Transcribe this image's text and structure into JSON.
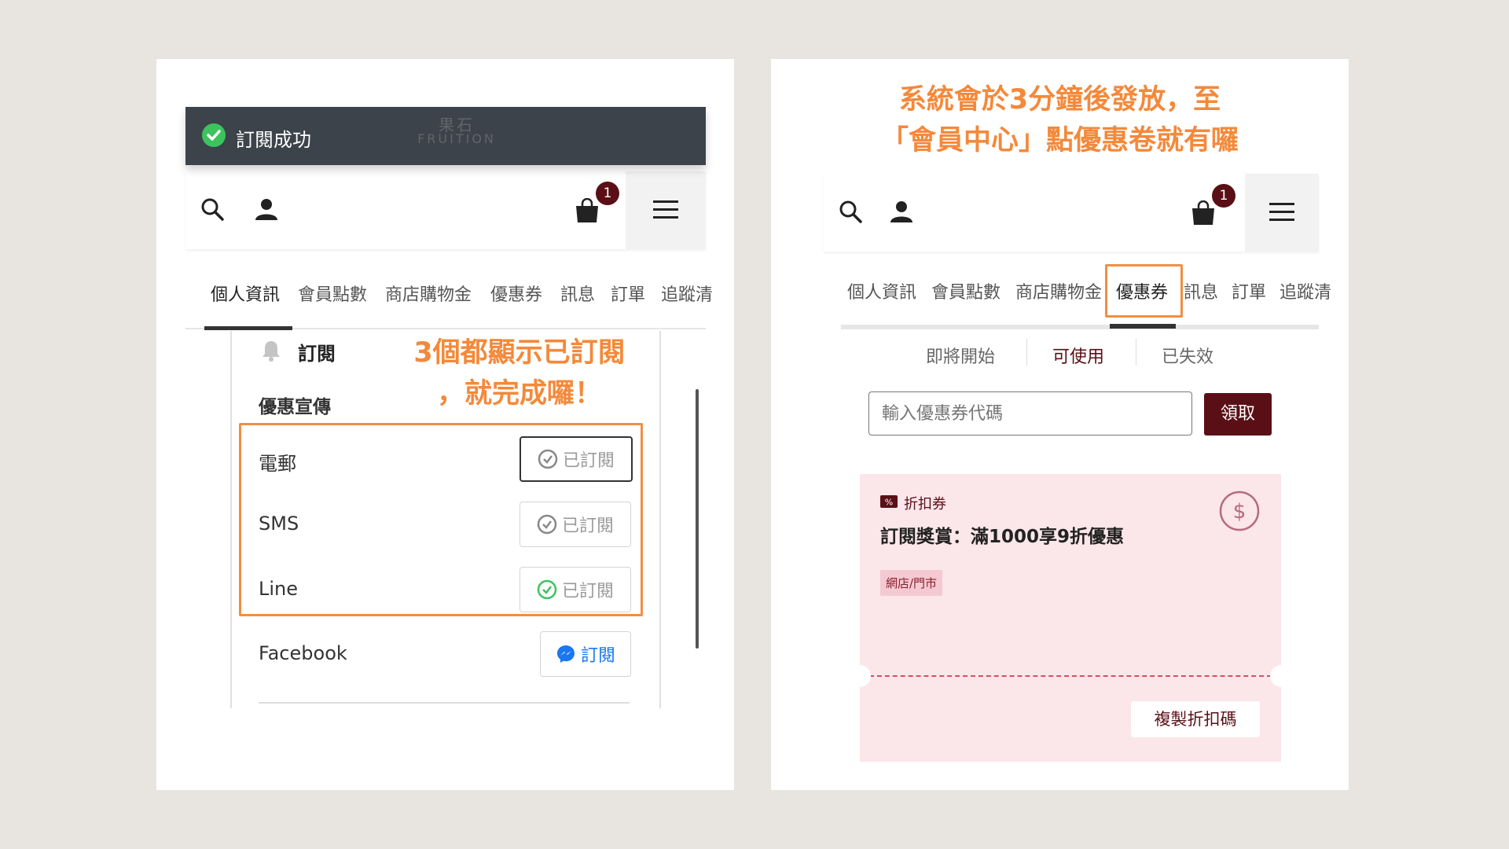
{
  "left": {
    "toast": {
      "text": "訂閱成功",
      "logo_cn": "果石",
      "logo_en": "FRUITION",
      "icon": "check-circle-icon"
    },
    "header": {
      "cart_count": "1"
    },
    "tabs": [
      "個人資訊",
      "會員點數",
      "商店購物金",
      "優惠券",
      "訊息",
      "訂單",
      "追蹤清"
    ],
    "section_title": "訂閱",
    "group_title": "優惠宣傳",
    "annotation": [
      "3個都顯示已訂閱",
      "，就完成囉！"
    ],
    "rows": [
      {
        "label": "電郵",
        "button": "已訂閱",
        "state": "subscribed"
      },
      {
        "label": "SMS",
        "button": "已訂閱",
        "state": "subscribed"
      },
      {
        "label": "Line",
        "button": "已訂閱",
        "state": "subscribed-green"
      },
      {
        "label": "Facebook",
        "button": "訂閱",
        "state": "messenger"
      }
    ]
  },
  "right": {
    "annotation": [
      "系統會於3分鐘後發放，至",
      "「會員中心」點優惠卷就有囉"
    ],
    "header": {
      "cart_count": "1"
    },
    "tabs": [
      "個人資訊",
      "會員點數",
      "商店購物金",
      "優惠券",
      "訊息",
      "訂單",
      "追蹤清"
    ],
    "segments": [
      "即將開始",
      "可使用",
      "已失效"
    ],
    "active_segment": "可使用",
    "coupon_input": {
      "placeholder": "輸入優惠券代碼"
    },
    "claim_button": "領取",
    "coupon": {
      "type": "折扣券",
      "title": "訂閱獎賞：滿1000享9折優惠",
      "tag": "網店/門市",
      "copy_button": "複製折扣碼",
      "icon": "dollar-circle-icon"
    }
  },
  "colors": {
    "annotation": "#f4893a",
    "brand_dark": "#5a0f16",
    "toast_bg": "#3d434a",
    "success_green": "#3cc35e",
    "messenger_blue": "#1877f2",
    "coupon_bg": "#fbe6ea"
  }
}
